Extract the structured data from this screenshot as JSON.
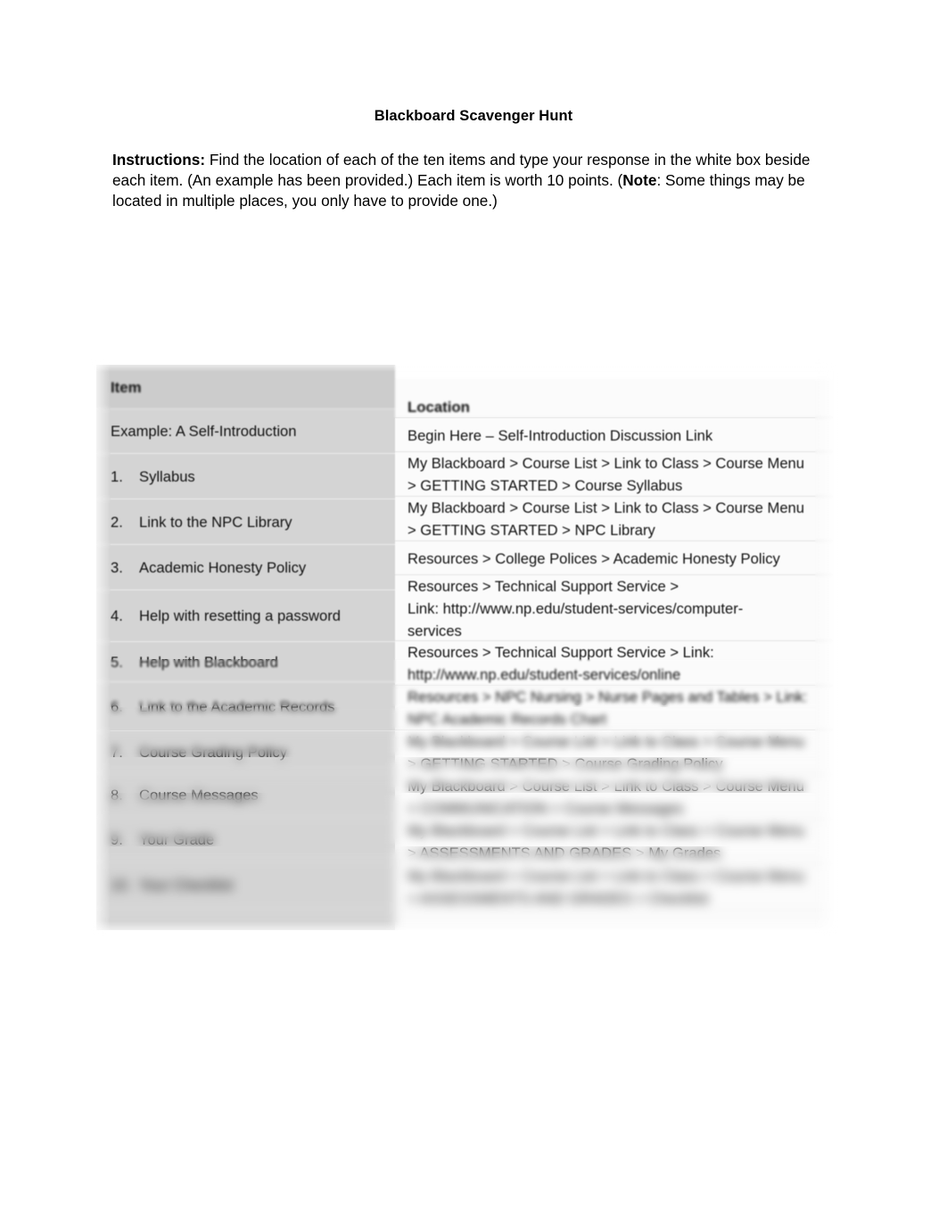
{
  "document": {
    "title": "Blackboard Scavenger Hunt",
    "instructions": {
      "label": "Instructions:",
      "text_part1": " Find the location of each of the ten items and type your response in the white box beside each item.  (An example has been provided.)  Each item is worth 10 points.  (",
      "note_label": "Note",
      "text_part2": ":  Some things may be located in multiple places, you only have to provide one.)"
    }
  },
  "table": {
    "headers": {
      "item": "Item",
      "location": "Location"
    },
    "rows": [
      {
        "number": "",
        "item": "Example:  A Self-Introduction",
        "location_lines": [
          "Begin Here – Self-Introduction Discussion Link"
        ],
        "legible": true
      },
      {
        "number": "1.",
        "item": "Syllabus",
        "location_lines": [
          "My Blackboard > Course List > Link to Class > Course Menu",
          "> GETTING STARTED > Course Syllabus"
        ],
        "legible": true
      },
      {
        "number": "2.",
        "item": "Link to the NPC Library",
        "location_lines": [
          "My Blackboard > Course List > Link to Class > Course Menu",
          "> GETTING STARTED > NPC Library"
        ],
        "legible": true
      },
      {
        "number": "3.",
        "item": "Academic Honesty Policy",
        "location_lines": [
          "Resources > College Polices > Academic Honesty Policy"
        ],
        "legible": true
      },
      {
        "number": "4.",
        "item": "Help with resetting a password",
        "location_lines": [
          "Resources > Technical Support Service >",
          "Link: http://www.np.edu/student-services/computer-",
          "services"
        ],
        "legible": true
      },
      {
        "number": "5.",
        "item": "Help with Blackboard",
        "location_lines": [
          "Resources > Technical Support Service > Link:",
          "http://www.np.edu/student-services/online"
        ],
        "legible": false
      },
      {
        "number": "6.",
        "item": "Link to the Academic Records",
        "location_lines": [
          "Resources > NPC Nursing > Nurse Pages and Tables > Link:",
          "NPC Academic Records Chart"
        ],
        "legible": false
      },
      {
        "number": "7.",
        "item": "Course Grading Policy",
        "location_lines": [
          "My Blackboard > Course List > Link to Class > Course Menu",
          "> GETTING STARTED > Course Grading Policy"
        ],
        "legible": false
      },
      {
        "number": "8.",
        "item": "Course Messages",
        "location_lines": [
          "My Blackboard > Course List > Link to Class > Course Menu",
          "> COMMUNICATION > Course Messages"
        ],
        "legible": false
      },
      {
        "number": "9.",
        "item": "Your Grade",
        "location_lines": [
          "My Blackboard > Course List > Link to Class > Course Menu",
          "> ASSESSMENTS AND GRADES > My Grades"
        ],
        "legible": false
      },
      {
        "number": "10.",
        "item": "Your Checklist",
        "location_lines": [
          "My Blackboard > Course List > Link to Class > Course Menu",
          "> ASSESSMENTS AND GRADES > Checklist"
        ],
        "legible": false
      }
    ]
  },
  "colors": {
    "page_background": "#ffffff",
    "left_column_background": "#d4d4d4",
    "right_column_background": "#fbfbfb",
    "header_band": "#cccccc",
    "text": "#111111"
  }
}
